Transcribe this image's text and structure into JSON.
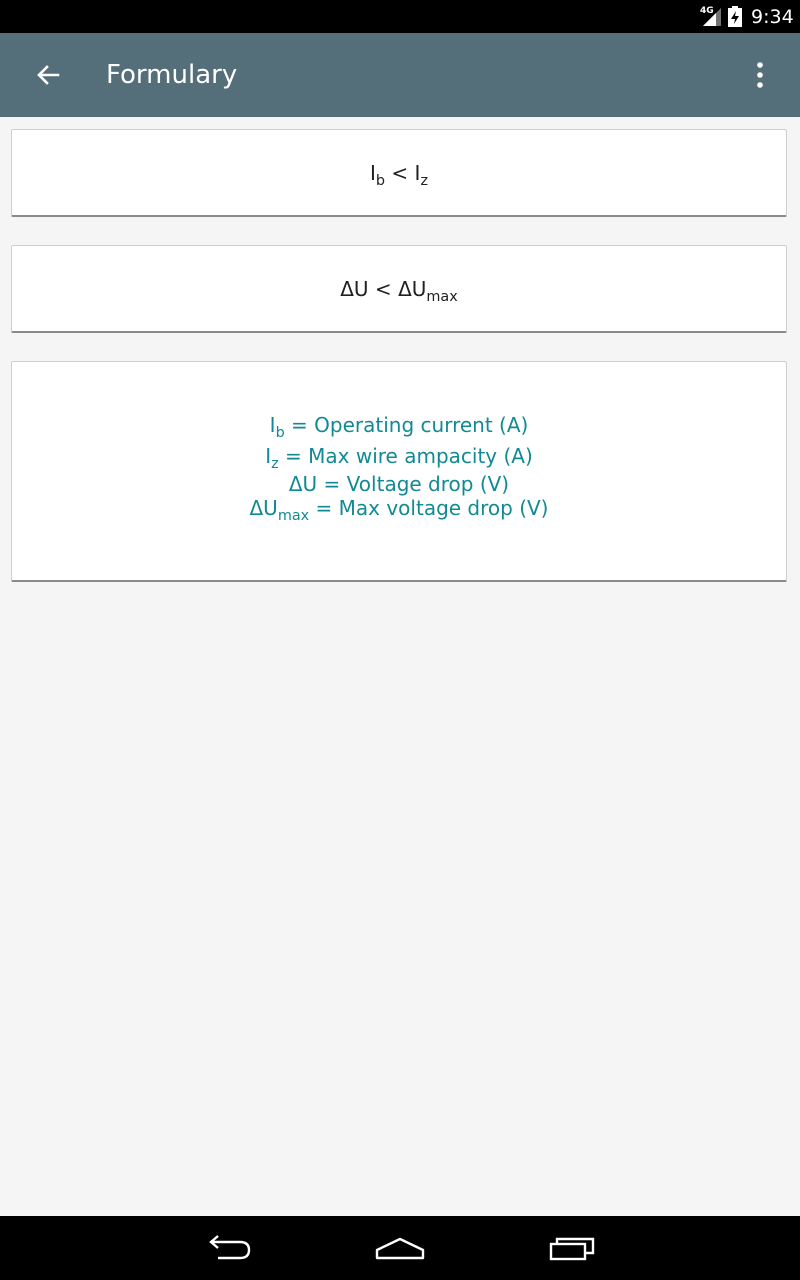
{
  "status_bar": {
    "network": "4G",
    "time": "9:34",
    "icons": [
      "signal-icon",
      "battery-charging-icon"
    ]
  },
  "app_bar": {
    "title": "Formulary",
    "icons": [
      "back-arrow-icon",
      "overflow-menu-icon"
    ]
  },
  "formulas": {
    "f1": {
      "lhs": "I",
      "lhs_sub": "b",
      "op": " < ",
      "rhs": "I",
      "rhs_sub": "z"
    },
    "f2": {
      "lhs": "ΔU",
      "op": " < ",
      "rhs": "ΔU",
      "rhs_sub": "max"
    }
  },
  "legend": {
    "l1": {
      "sym": "I",
      "sub": "b",
      "text": " = Operating current (A)"
    },
    "l2": {
      "sym": "I",
      "sub": "z",
      "text": " = Max wire ampacity (A)"
    },
    "l3": {
      "sym": "ΔU",
      "text": " = Voltage drop (V)"
    },
    "l4": {
      "sym": "ΔU",
      "sub": "max",
      "text": " = Max voltage drop (V)"
    }
  },
  "nav_bar": {
    "icons": [
      "nav-back-icon",
      "nav-home-icon",
      "nav-recents-icon"
    ]
  },
  "colors": {
    "app_bar": "#546e7a",
    "accent_text": "#128a94",
    "background": "#f5f5f5"
  }
}
